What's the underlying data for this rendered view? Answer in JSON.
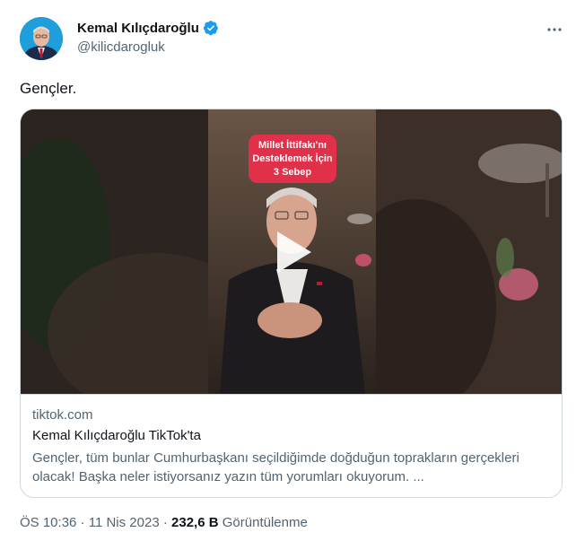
{
  "author": {
    "name": "Kemal Kılıçdaroğlu",
    "handle": "@kilicdarogluk",
    "verified_color": "#1d9bf0"
  },
  "tweet": {
    "text": "Gençler."
  },
  "card": {
    "overlay_lines": [
      "Millet İttifakı'nı",
      "Desteklemek İçin",
      "3 Sebep"
    ],
    "domain": "tiktok.com",
    "title": "Kemal Kılıçdaroğlu TikTok'ta",
    "description": "Gençler, tüm bunlar Cumhurbaşkanı seçildiğimde doğduğun toprakların gerçekleri olacak! Başka neler istiyorsanız yazın tüm yorumları okuyorum. ..."
  },
  "meta": {
    "time": "ÖS 10:36",
    "separator": "·",
    "date": "11 Nis 2023",
    "views_count": "232,6 B",
    "views_label": "Görüntülenme"
  },
  "icons": {
    "more": "more-horizontal-icon",
    "verified": "verified-badge-icon",
    "play": "play-icon"
  },
  "colors": {
    "text_primary": "#0f1419",
    "text_secondary": "#536471",
    "border": "#cfd9de",
    "badge_red": "#e0304a"
  }
}
